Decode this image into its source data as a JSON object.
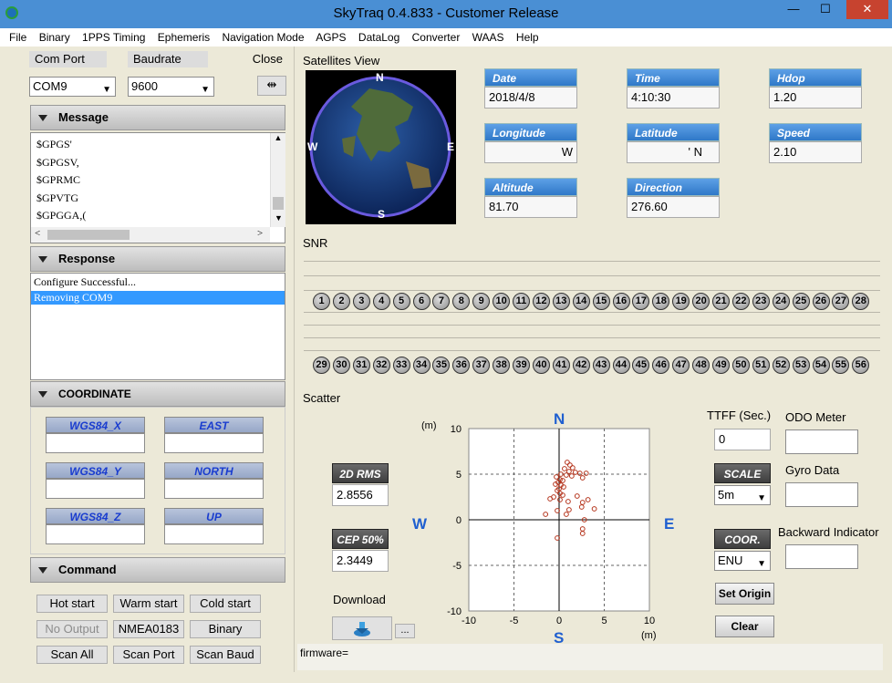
{
  "window": {
    "title": "SkyTraq 0.4.833  - Customer Release",
    "min": "—",
    "max": "☐",
    "close": "✕"
  },
  "menu": [
    "File",
    "Binary",
    "1PPS Timing",
    "Ephemeris",
    "Navigation Mode",
    "AGPS",
    "DataLog",
    "Converter",
    "WAAS",
    "Help"
  ],
  "connection": {
    "com_label": "Com Port",
    "baud_label": "Baudrate",
    "close_label": "Close",
    "com_value": "COM9",
    "baud_value": "9600"
  },
  "message": {
    "header": "Message",
    "lines": [
      "$GPGS'",
      "$GPGSV,",
      "$GPRMC",
      "$GPVTG",
      "$GPGGA,("
    ]
  },
  "response": {
    "header": "Response",
    "lines": [
      "Configure Successful...",
      "Removing COM9"
    ]
  },
  "coordinate": {
    "header": "COORDINATE",
    "labels": [
      "WGS84_X",
      "EAST",
      "WGS84_Y",
      "NORTH",
      "WGS84_Z",
      "UP"
    ]
  },
  "command": {
    "header": "Command",
    "buttons": [
      "Hot start",
      "Warm start",
      "Cold start",
      "No Output",
      "NMEA0183",
      "Binary",
      "Scan All",
      "Scan Port",
      "Scan Baud"
    ]
  },
  "satellites_view": {
    "label": "Satellites View",
    "n": "N",
    "s": "S",
    "e": "E",
    "w": "W"
  },
  "info": {
    "date_label": "Date",
    "date": "2018/4/8",
    "time_label": "Time",
    "time": "4:10:30",
    "hdop_label": "Hdop",
    "hdop": "1.20",
    "lon_label": "Longitude",
    "lon": "W",
    "lat_label": "Latitude",
    "lat": "' N",
    "speed_label": "Speed",
    "speed": "2.10",
    "alt_label": "Altitude",
    "alt": "81.70",
    "dir_label": "Direction",
    "dir": "276.60"
  },
  "snr": {
    "label": "SNR",
    "row1": [
      "1",
      "2",
      "3",
      "4",
      "5",
      "6",
      "7",
      "8",
      "9",
      "10",
      "11",
      "12",
      "13",
      "14",
      "15",
      "16",
      "17",
      "18",
      "19",
      "20",
      "21",
      "22",
      "23",
      "24",
      "25",
      "26",
      "27",
      "28"
    ],
    "row2": [
      "29",
      "30",
      "31",
      "32",
      "33",
      "34",
      "35",
      "36",
      "37",
      "38",
      "39",
      "40",
      "41",
      "42",
      "43",
      "44",
      "45",
      "46",
      "47",
      "48",
      "49",
      "50",
      "51",
      "52",
      "53",
      "54",
      "55",
      "56"
    ]
  },
  "scatter": {
    "label": "Scatter",
    "unit": "(m)",
    "n": "N",
    "s": "S",
    "e": "E",
    "w": "W",
    "rms_label": "2D RMS",
    "rms": "2.8556",
    "cep_label": "CEP 50%",
    "cep": "2.3449",
    "download_label": "Download",
    "dots_label": "...",
    "ttff_label": "TTFF (Sec.)",
    "ttff": "0",
    "odo_label": "ODO Meter",
    "scale_label": "SCALE",
    "scale": "5m",
    "gyro_label": "Gyro Data",
    "coor_label": "COOR.",
    "coor": "ENU",
    "backward_label": "Backward Indicator",
    "set_origin": "Set Origin",
    "clear": "Clear",
    "firmware": "firmware="
  },
  "chart_data": {
    "type": "scatter",
    "xlabel": "(m)",
    "ylabel": "(m)",
    "xlim": [
      -10,
      10
    ],
    "ylim": [
      -10,
      10
    ],
    "xticks": [
      "-10",
      "-5",
      "0",
      "5",
      "10"
    ],
    "yticks": [
      "10",
      "5",
      "0",
      "-5",
      "-10"
    ],
    "grid": true,
    "color": "#b5351d",
    "points": [
      [
        0.9,
        6.3
      ],
      [
        1.2,
        6.0
      ],
      [
        0.6,
        5.6
      ],
      [
        1.5,
        5.7
      ],
      [
        1.8,
        5.2
      ],
      [
        1.1,
        5.3
      ],
      [
        0.2,
        5.0
      ],
      [
        2.3,
        5.1
      ],
      [
        0.8,
        4.9
      ],
      [
        1.4,
        4.8
      ],
      [
        2.6,
        4.6
      ],
      [
        3.0,
        5.1
      ],
      [
        0.1,
        4.4
      ],
      [
        -0.3,
        4.7
      ],
      [
        0.4,
        4.3
      ],
      [
        -0.1,
        4.1
      ],
      [
        0.2,
        3.8
      ],
      [
        -0.4,
        3.9
      ],
      [
        0.5,
        3.6
      ],
      [
        0.0,
        3.4
      ],
      [
        -0.2,
        3.2
      ],
      [
        0.1,
        2.9
      ],
      [
        0.4,
        2.7
      ],
      [
        -0.6,
        2.5
      ],
      [
        0.1,
        2.2
      ],
      [
        -1.0,
        2.3
      ],
      [
        2.0,
        2.6
      ],
      [
        1.0,
        2.0
      ],
      [
        3.2,
        2.2
      ],
      [
        2.6,
        1.9
      ],
      [
        2.5,
        1.4
      ],
      [
        1.1,
        1.1
      ],
      [
        0.8,
        0.6
      ],
      [
        3.9,
        1.2
      ],
      [
        -0.2,
        1.0
      ],
      [
        -1.5,
        0.6
      ],
      [
        2.8,
        0.0
      ],
      [
        2.6,
        -1.0
      ],
      [
        2.6,
        -1.5
      ],
      [
        -0.2,
        -2.0
      ]
    ]
  }
}
